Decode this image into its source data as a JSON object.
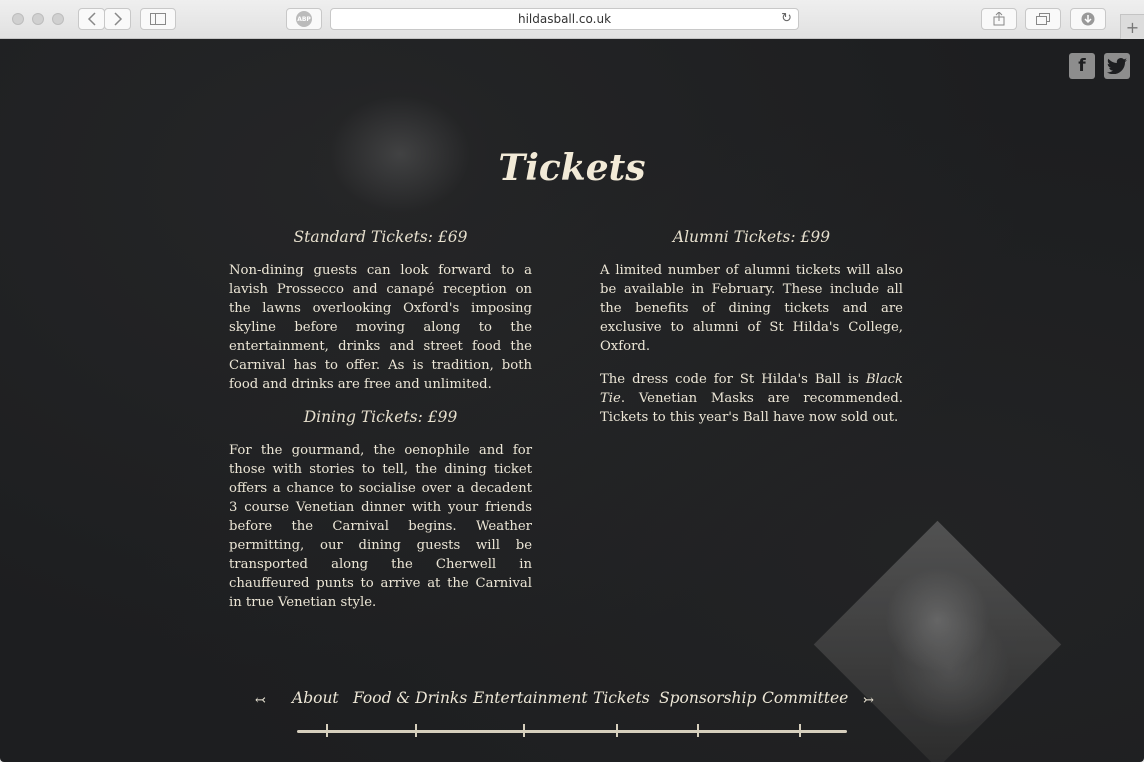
{
  "browser": {
    "url": "hildasball.co.uk",
    "back_icon": "chevron-left-icon",
    "forward_icon": "chevron-right-icon",
    "sidebar_icon": "sidebar-icon",
    "adblock_label": "ABP",
    "reload_icon": "reload-icon",
    "share_icon": "share-icon",
    "tabs_icon": "tabs-icon",
    "download_icon": "download-icon",
    "newtab_label": "+"
  },
  "social": {
    "facebook": "f",
    "twitter": "t"
  },
  "page": {
    "title": "Tickets",
    "standard": {
      "heading": "Standard Tickets: £69",
      "body": "Non-dining guests can look forward to a lavish Prossecco and canapé reception on the lawns overlooking Oxford's imposing skyline before moving along to the entertainment, drinks and street food the Carnival has to offer. As is tradition, both food and drinks are free and unlimited."
    },
    "dining": {
      "heading": "Dining Tickets: £99",
      "body": "For the gourmand, the oenophile and for those with stories to tell, the dining ticket offers a chance to socialise over a decadent 3 course Venetian dinner with your friends before the Carnival begins. Weather permitting, our dining guests will be transported along the Cherwell in chauffeured punts to arrive at the Carnival in true Venetian style."
    },
    "alumni": {
      "heading": "Alumni Tickets: £99",
      "body": "A limited number of alumni tickets will also be available in February. These include all the benefits of dining tickets and are exclusive to alumni of St Hilda's College, Oxford."
    },
    "dress": {
      "before": "The dress code for St Hilda's Ball is ",
      "emphasis": "Black Tie",
      "after": ". Venetian Masks are recommended. Tickets to this year's Ball have now sold out."
    }
  },
  "nav": {
    "prev": "↢",
    "next": "↣",
    "items": [
      "About",
      "Food & Drinks",
      "Entertainment",
      "Tickets",
      "Sponsorship",
      "Committee"
    ]
  }
}
